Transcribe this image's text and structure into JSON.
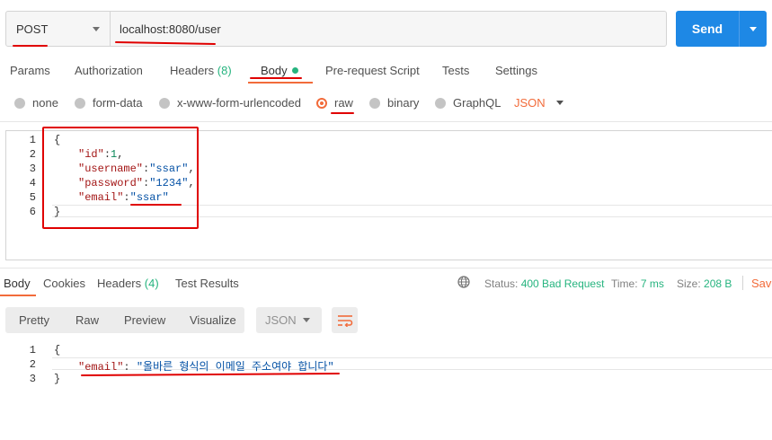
{
  "request": {
    "method": "POST",
    "url": "localhost:8080/user",
    "send_label": "Send"
  },
  "request_tabs": {
    "params": "Params",
    "authorization": "Authorization",
    "headers": "Headers",
    "headers_count": "(8)",
    "body": "Body",
    "prerequest": "Pre-request Script",
    "tests": "Tests",
    "settings": "Settings"
  },
  "body_types": {
    "none": "none",
    "form_data": "form-data",
    "urlencoded": "x-www-form-urlencoded",
    "raw": "raw",
    "binary": "binary",
    "graphql": "GraphQL",
    "selected_type": "raw",
    "format": "JSON"
  },
  "request_body": {
    "line_numbers": [
      "1",
      "2",
      "3",
      "4",
      "5",
      "6"
    ],
    "open_brace": "{",
    "fields": [
      {
        "key": "\"id\"",
        "sep": ":",
        "value": "1",
        "end": ","
      },
      {
        "key": "\"username\"",
        "sep": ":",
        "value": "\"ssar\"",
        "end": ","
      },
      {
        "key": "\"password\"",
        "sep": ":",
        "value": "\"1234\"",
        "end": ","
      },
      {
        "key": "\"email\"",
        "sep": ":",
        "value": "\"ssar\"",
        "end": ""
      }
    ],
    "close_brace": "}"
  },
  "response_tabs": {
    "body": "Body",
    "cookies": "Cookies",
    "headers": "Headers",
    "headers_count": "(4)",
    "test_results": "Test Results"
  },
  "response_status": {
    "status_label": "Status:",
    "status_value": "400 Bad Request",
    "time_label": "Time:",
    "time_value": "7 ms",
    "size_label": "Size:",
    "size_value": "208 B",
    "save_label": "Save"
  },
  "response_view": {
    "pretty": "Pretty",
    "raw": "Raw",
    "preview": "Preview",
    "visualize": "Visualize",
    "format": "JSON"
  },
  "response_body": {
    "line_numbers": [
      "1",
      "2",
      "3"
    ],
    "open_brace": "{",
    "key": "\"email\"",
    "sep": ": ",
    "value": "\"올바른 형식의 이메일 주소여야 합니다\"",
    "close_brace": "}"
  },
  "colors": {
    "accent": "#f26b3a",
    "send_button": "#1e88e5",
    "success_green": "#26b47f",
    "annotation_red": "#e00000"
  },
  "icons": [
    "caret-down-icon",
    "globe-icon",
    "wrap-lines-icon"
  ]
}
